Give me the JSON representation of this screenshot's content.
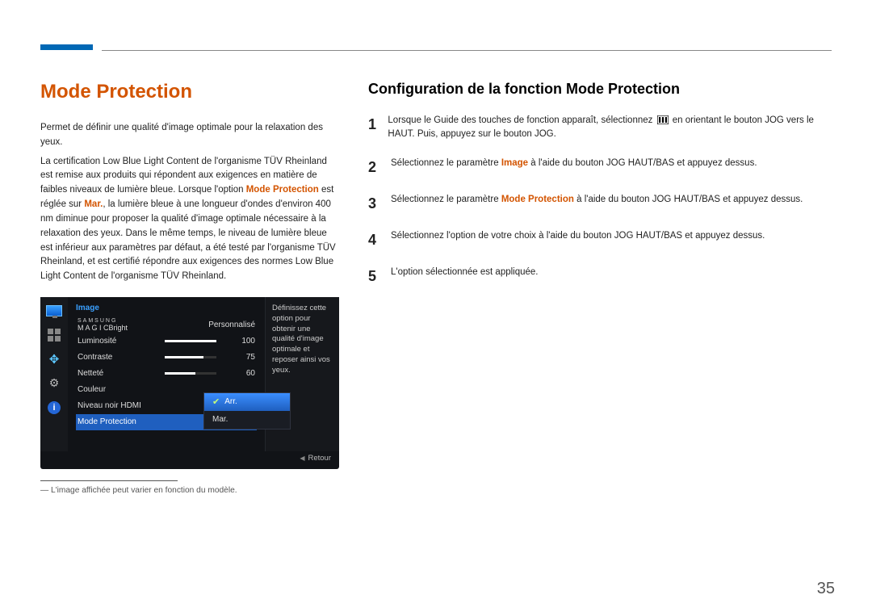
{
  "colors": {
    "accent_orange": "#d35400",
    "accent_blue": "#0068b5"
  },
  "left": {
    "heading": "Mode Protection",
    "para1": "Permet de définir une qualité d'image optimale pour la relaxation des yeux.",
    "para2_a": "La certification Low Blue Light Content de l'organisme TÜV Rheinland est remise aux produits qui répondent aux exigences en matière de faibles niveaux de lumière bleue. Lorsque l'option ",
    "para2_b_hl1": "Mode Protection",
    "para2_c": " est réglée sur ",
    "para2_d_hl2": "Mar.",
    "para2_e": ", la lumière bleue à une longueur d'ondes d'environ 400 nm diminue pour proposer la qualité d'image optimale nécessaire à la relaxation des yeux. Dans le même temps, le niveau de lumière bleue est inférieur aux paramètres par défaut, a été testé par l'organisme TÜV Rheinland, et est certifié répondre aux exigences des normes Low Blue Light Content de l'organisme TÜV Rheinland.",
    "footnote_dash": "―",
    "footnote": "L'image affichée peut varier en fonction du modèle."
  },
  "osd": {
    "title": "Image",
    "magic_top": "SAMSUNG",
    "magic_bottom": "M A G I C",
    "magic_suffix": "Bright",
    "magic_value": "Personnalisé",
    "rows": {
      "luminosite": {
        "label": "Luminosité",
        "value": "100",
        "pct": 100
      },
      "contraste": {
        "label": "Contraste",
        "value": "75",
        "pct": 75
      },
      "nettete": {
        "label": "Netteté",
        "value": "60",
        "pct": 60
      }
    },
    "couleur": "Couleur",
    "niveau_noir": "Niveau noir HDMI",
    "mode_protection": "Mode Protection",
    "popup": {
      "arr": "Arr.",
      "mar": "Mar."
    },
    "desc": "Définissez cette option pour obtenir une qualité d'image optimale et reposer ainsi vos yeux.",
    "retour": "Retour"
  },
  "right": {
    "heading": "Configuration de la fonction Mode Protection",
    "steps": {
      "1a": "Lorsque le Guide des touches de fonction apparaît, sélectionnez ",
      "1b": " en orientant le bouton JOG vers le HAUT. Puis, appuyez sur le bouton JOG.",
      "2a": "Sélectionnez le paramètre ",
      "2b_hl": "Image",
      "2c": " à l'aide du bouton JOG HAUT/BAS et appuyez dessus.",
      "3a": "Sélectionnez le paramètre ",
      "3b_hl": "Mode Protection",
      "3c": " à l'aide du bouton JOG HAUT/BAS et appuyez dessus.",
      "4": "Sélectionnez l'option de votre choix à l'aide du bouton JOG HAUT/BAS et appuyez dessus.",
      "5": "L'option sélectionnée est appliquée."
    },
    "nums": {
      "1": "1",
      "2": "2",
      "3": "3",
      "4": "4",
      "5": "5"
    }
  },
  "page_number": "35"
}
